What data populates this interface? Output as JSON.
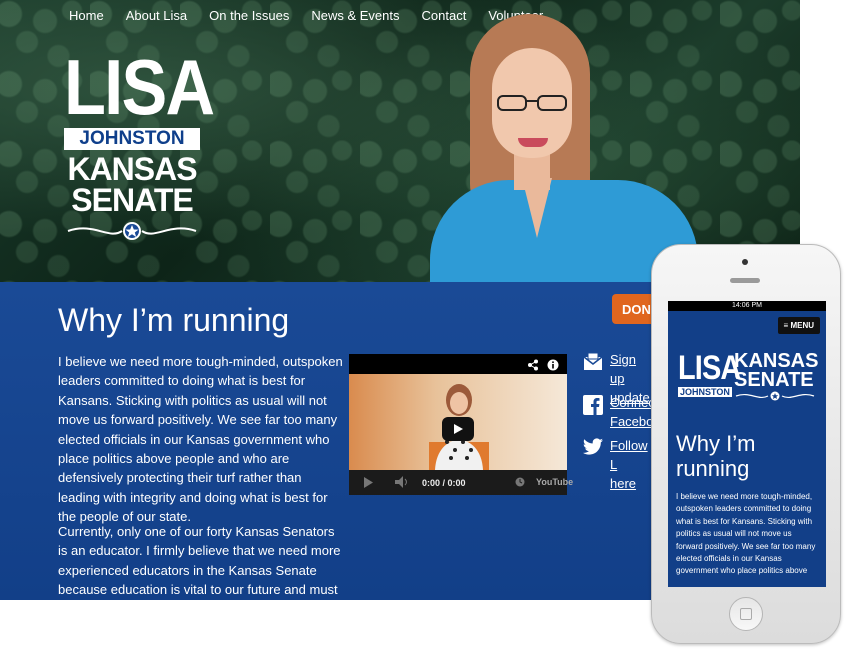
{
  "nav": {
    "items": [
      "Home",
      "About Lisa",
      "On the Issues",
      "News & Events",
      "Contact",
      "Volunteer"
    ]
  },
  "logo": {
    "line1": "LISA",
    "line2": "JOHNSTON",
    "line3": "KANSAS",
    "line4": "SENATE"
  },
  "main": {
    "heading": "Why I’m running",
    "paragraph1": "I believe we need more tough-minded, outspoken leaders committed to doing what is best for Kansans. Sticking with politics as usual will not move us forward positively. We see far too many elected officials in our Kansas government who place politics above people and who are defensively protecting their turf rather than leading with integrity and doing what is best for the people of our state.",
    "paragraph2": "Currently, only one of our forty Kansas Senators is an educator. I firmly believe that we need more experienced educators in the Kansas Senate because education is vital to our future and must"
  },
  "video": {
    "time": "0:00 / 0:00",
    "brand": "YouTube"
  },
  "sidebar": {
    "donate_label": "DON",
    "links": [
      {
        "label": "Sign up\nupdate",
        "icon": "envelope-icon"
      },
      {
        "label": "Connect\nFaceboo",
        "icon": "facebook-icon"
      },
      {
        "label": "Follow L\nhere",
        "icon": "twitter-icon"
      }
    ]
  },
  "phone": {
    "status_time": "14:06 PM",
    "menu_label": "≡ MENU",
    "logo": {
      "lisa": "LISA",
      "johnston": "JOHNSTON",
      "kansas": "KANSAS",
      "senate": "SENATE"
    },
    "heading": "Why I’m running",
    "paragraph": "I believe we need more tough-minded, outspoken leaders committed to doing what is best for Kansans. Sticking with politics as usual will not move us forward positively. We see far too many elected officials in our Kansas government who place politics above"
  },
  "colors": {
    "brand_blue": "#123f88",
    "donate_orange": "#e0661e",
    "jacket_blue": "#2e9bd6"
  }
}
